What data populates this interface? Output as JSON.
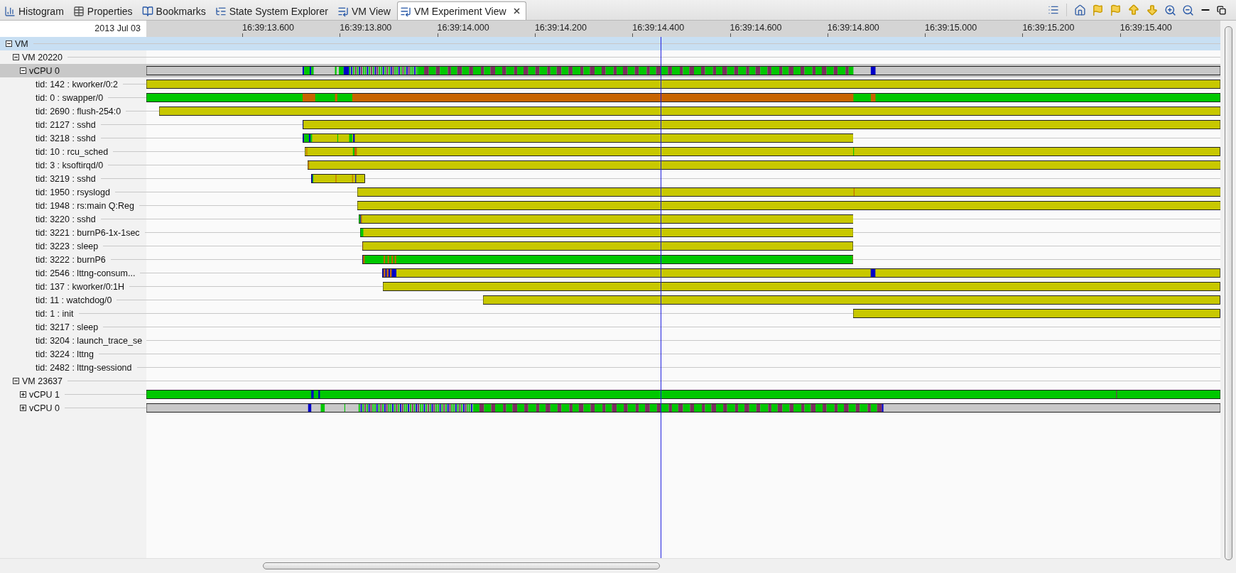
{
  "tabs": [
    {
      "label": "Histogram",
      "selected": false
    },
    {
      "label": "Properties",
      "selected": false
    },
    {
      "label": "Bookmarks",
      "selected": false
    },
    {
      "label": "State System Explorer",
      "selected": false
    },
    {
      "label": "VM View",
      "selected": false
    },
    {
      "label": "VM Experiment View",
      "selected": true
    }
  ],
  "timeline": {
    "date": "2013 Jul 03",
    "ticks": [
      "16:39:13.600",
      "16:39:13.800",
      "16:39:14.000",
      "16:39:14.200",
      "16:39:14.400",
      "16:39:14.600",
      "16:39:14.800",
      "16:39:15.000",
      "16:39:15.200",
      "16:39:15.400"
    ]
  },
  "tree": [
    {
      "label": "VM",
      "expanded": true,
      "selected": true,
      "highlighted": false,
      "children": [
        {
          "label": "VM 20220",
          "expanded": true,
          "selected": false,
          "highlighted": false,
          "children": [
            {
              "label": "vCPU 0",
              "expanded": true,
              "selected": false,
              "highlighted": true,
              "children": [
                {
                  "label": "tid: 142 : kworker/0:2",
                  "selected": false,
                  "highlighted": false
                },
                {
                  "label": "tid: 0 : swapper/0",
                  "selected": false,
                  "highlighted": false
                },
                {
                  "label": "tid: 2690 : flush-254:0",
                  "selected": false,
                  "highlighted": false
                },
                {
                  "label": "tid: 2127 : sshd",
                  "selected": false,
                  "highlighted": false
                },
                {
                  "label": "tid: 3218 : sshd",
                  "selected": false,
                  "highlighted": false
                },
                {
                  "label": "tid: 10 : rcu_sched",
                  "selected": false,
                  "highlighted": false
                },
                {
                  "label": "tid: 3 : ksoftirqd/0",
                  "selected": false,
                  "highlighted": false
                },
                {
                  "label": "tid: 3219 : sshd",
                  "selected": false,
                  "highlighted": false
                },
                {
                  "label": "tid: 1950 : rsyslogd",
                  "selected": false,
                  "highlighted": false
                },
                {
                  "label": "tid: 1948 : rs:main Q:Reg",
                  "selected": false,
                  "highlighted": false
                },
                {
                  "label": "tid: 3220 : sshd",
                  "selected": false,
                  "highlighted": false
                },
                {
                  "label": "tid: 3221 : burnP6-1x-1sec",
                  "selected": false,
                  "highlighted": false
                },
                {
                  "label": "tid: 3223 : sleep",
                  "selected": false,
                  "highlighted": false
                },
                {
                  "label": "tid: 3222 : burnP6",
                  "selected": false,
                  "highlighted": false
                },
                {
                  "label": "tid: 2546 : lttng-consum...",
                  "selected": false,
                  "highlighted": false
                },
                {
                  "label": "tid: 137 : kworker/0:1H",
                  "selected": false,
                  "highlighted": false
                },
                {
                  "label": "tid: 11 : watchdog/0",
                  "selected": false,
                  "highlighted": false
                },
                {
                  "label": "tid: 1 : init",
                  "selected": false,
                  "highlighted": false
                },
                {
                  "label": "tid: 3217 : sleep",
                  "selected": false,
                  "highlighted": false
                },
                {
                  "label": "tid: 3204 : launch_trace_se",
                  "selected": false,
                  "highlighted": false
                },
                {
                  "label": "tid: 3224 : lttng",
                  "selected": false,
                  "highlighted": false
                },
                {
                  "label": "tid: 2482 : lttng-sessiond",
                  "selected": false,
                  "highlighted": false
                }
              ]
            }
          ]
        },
        {
          "label": "VM 23637",
          "expanded": true,
          "selected": false,
          "highlighted": false,
          "children": [
            {
              "label": "vCPU 1",
              "expanded": false,
              "selected": false,
              "highlighted": false
            },
            {
              "label": "vCPU 0",
              "expanded": false,
              "selected": false,
              "highlighted": false
            }
          ]
        }
      ]
    }
  ]
}
